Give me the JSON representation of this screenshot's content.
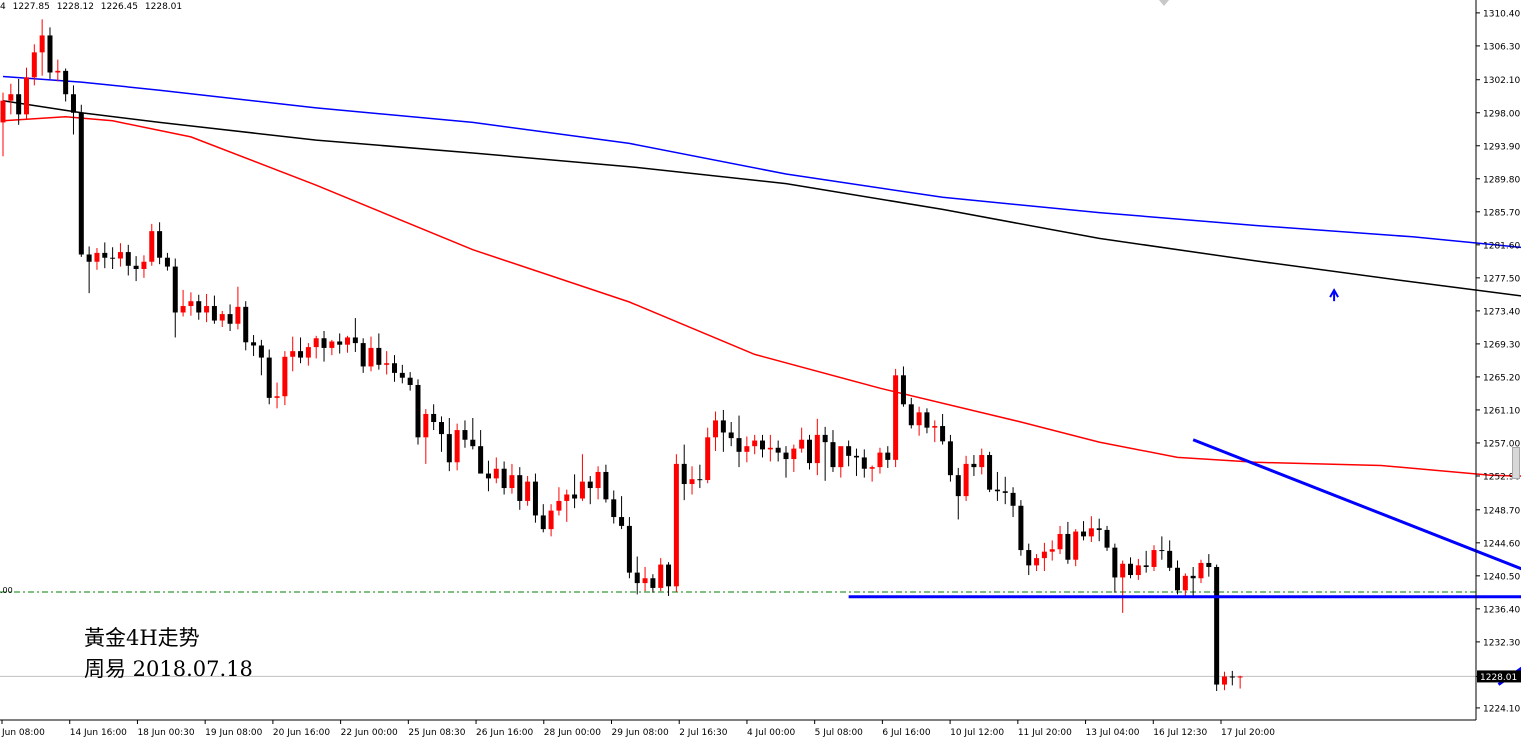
{
  "header": {
    "symbol_fragment": "4",
    "open": "1227.85",
    "high": "1228.12",
    "low": "1226.45",
    "close": "1228.01"
  },
  "caption": {
    "line1": "黃金4H走势",
    "line2": "周易  2018.07.18"
  },
  "level_tag": ".00",
  "colors": {
    "bull": "#ff0000",
    "bear": "#000000",
    "ma_red": "#ff0000",
    "ma_black": "#000000",
    "ma_blue": "#0000ff",
    "annotation": "#0000ff",
    "dashed_level": "#008000",
    "price_line": "#c0c0c0"
  },
  "chart_data": {
    "type": "candlestick",
    "title": "",
    "y_axis": {
      "side": "right",
      "range": [
        1222.6,
        1312.0
      ],
      "ticks": [
        "1310.40",
        "1306.30",
        "1302.10",
        "1298.00",
        "1293.90",
        "1289.80",
        "1285.70",
        "1281.60",
        "1277.50",
        "1273.40",
        "1269.30",
        "1265.20",
        "1261.10",
        "1257.00",
        "1252.90",
        "1248.70",
        "1244.60",
        "1240.50",
        "1236.40",
        "1232.30",
        "1228.01",
        "1224.10"
      ],
      "current_price_label": "1228.01"
    },
    "x_axis": {
      "labels": [
        "Jun 08:00",
        "14 Jun 16:00",
        "18 Jun 00:30",
        "19 Jun 08:00",
        "20 Jun 16:00",
        "22 Jun 00:00",
        "25 Jun 08:30",
        "26 Jun 16:00",
        "28 Jun 00:00",
        "29 Jun 08:00",
        "2 Jul 16:30",
        "4 Jul 00:00",
        "5 Jul 08:00",
        "6 Jul 16:00",
        "10 Jul 12:00",
        "11 Jul 20:00",
        "13 Jul 04:00",
        "16 Jul 12:30",
        "17 Jul 20:00"
      ]
    },
    "candles": [
      [
        1296.8,
        1300.5,
        1292.6,
        1299.5
      ],
      [
        1299.5,
        1301.6,
        1297.8,
        1300.3
      ],
      [
        1300.3,
        1302.2,
        1296.5,
        1297.8
      ],
      [
        1297.8,
        1303.6,
        1297.2,
        1302.4
      ],
      [
        1302.4,
        1306.5,
        1301.4,
        1305.5
      ],
      [
        1305.5,
        1309.6,
        1302.6,
        1307.6
      ],
      [
        1307.6,
        1308.6,
        1302.2,
        1303.0
      ],
      [
        1303.0,
        1304.6,
        1301.9,
        1303.2
      ],
      [
        1303.2,
        1303.5,
        1299.4,
        1300.3
      ],
      [
        1300.3,
        1301.4,
        1295.3,
        1298.0
      ],
      [
        1298.0,
        1299.0,
        1280.1,
        1280.4
      ],
      [
        1280.4,
        1281.4,
        1275.6,
        1279.5
      ],
      [
        1279.5,
        1281.2,
        1278.5,
        1280.6
      ],
      [
        1280.6,
        1281.9,
        1278.7,
        1280.0
      ],
      [
        1280.0,
        1281.3,
        1278.6,
        1279.9
      ],
      [
        1279.9,
        1281.8,
        1278.9,
        1280.7
      ],
      [
        1280.7,
        1281.6,
        1277.8,
        1279.0
      ],
      [
        1279.0,
        1280.2,
        1277.1,
        1278.6
      ],
      [
        1278.6,
        1280.3,
        1277.5,
        1279.5
      ],
      [
        1279.5,
        1284.2,
        1279.0,
        1283.3
      ],
      [
        1283.3,
        1284.4,
        1279.2,
        1280.0
      ],
      [
        1280.0,
        1280.6,
        1278.4,
        1278.9
      ],
      [
        1278.9,
        1279.9,
        1270.1,
        1273.2
      ],
      [
        1273.2,
        1276.0,
        1272.7,
        1274.0
      ],
      [
        1274.0,
        1275.7,
        1272.8,
        1274.6
      ],
      [
        1274.6,
        1275.4,
        1272.3,
        1273.2
      ],
      [
        1273.2,
        1275.5,
        1272.0,
        1274.0
      ],
      [
        1274.0,
        1275.3,
        1271.8,
        1272.2
      ],
      [
        1272.2,
        1273.4,
        1271.4,
        1273.0
      ],
      [
        1273.0,
        1274.2,
        1270.9,
        1271.8
      ],
      [
        1271.8,
        1276.4,
        1271.1,
        1273.9
      ],
      [
        1273.9,
        1274.6,
        1268.5,
        1269.5
      ],
      [
        1269.5,
        1270.4,
        1267.8,
        1269.1
      ],
      [
        1269.1,
        1269.8,
        1265.4,
        1267.6
      ],
      [
        1267.6,
        1268.6,
        1261.8,
        1262.6
      ],
      [
        1262.6,
        1264.5,
        1261.3,
        1262.8
      ],
      [
        1262.8,
        1268.4,
        1261.7,
        1267.7
      ],
      [
        1267.7,
        1270.2,
        1265.9,
        1268.4
      ],
      [
        1268.4,
        1270.1,
        1266.9,
        1267.6
      ],
      [
        1267.6,
        1269.4,
        1266.6,
        1268.9
      ],
      [
        1268.9,
        1270.3,
        1267.5,
        1270.0
      ],
      [
        1270.0,
        1270.9,
        1267.1,
        1268.8
      ],
      [
        1268.8,
        1269.8,
        1267.9,
        1269.6
      ],
      [
        1269.6,
        1270.6,
        1268.1,
        1269.2
      ],
      [
        1269.2,
        1270.3,
        1268.2,
        1270.1
      ],
      [
        1270.1,
        1272.5,
        1268.3,
        1269.4
      ],
      [
        1269.4,
        1270.0,
        1265.7,
        1266.5
      ],
      [
        1266.5,
        1270.2,
        1265.9,
        1268.8
      ],
      [
        1268.8,
        1270.6,
        1266.1,
        1266.7
      ],
      [
        1266.7,
        1268.4,
        1265.5,
        1266.9
      ],
      [
        1266.9,
        1267.9,
        1264.6,
        1265.7
      ],
      [
        1265.7,
        1266.7,
        1264.4,
        1265.1
      ],
      [
        1265.1,
        1265.8,
        1263.5,
        1264.2
      ],
      [
        1264.2,
        1264.9,
        1256.8,
        1257.7
      ],
      [
        1257.7,
        1261.2,
        1254.4,
        1260.6
      ],
      [
        1260.6,
        1261.8,
        1258.6,
        1259.6
      ],
      [
        1259.6,
        1260.3,
        1255.9,
        1258.1
      ],
      [
        1258.1,
        1260.1,
        1253.5,
        1254.6
      ],
      [
        1254.6,
        1259.4,
        1253.6,
        1258.6
      ],
      [
        1258.6,
        1259.8,
        1256.4,
        1257.4
      ],
      [
        1257.4,
        1260.1,
        1256.2,
        1256.6
      ],
      [
        1256.6,
        1258.6,
        1253.5,
        1253.2
      ],
      [
        1253.2,
        1254.8,
        1251.0,
        1252.6
      ],
      [
        1252.6,
        1255.2,
        1252.0,
        1253.8
      ],
      [
        1253.8,
        1254.7,
        1250.6,
        1251.4
      ],
      [
        1251.4,
        1254.4,
        1250.7,
        1253.0
      ],
      [
        1253.0,
        1254.0,
        1248.7,
        1249.8
      ],
      [
        1249.8,
        1252.9,
        1249.2,
        1252.2
      ],
      [
        1252.2,
        1253.2,
        1247.1,
        1248.0
      ],
      [
        1248.0,
        1249.4,
        1245.9,
        1246.3
      ],
      [
        1246.3,
        1249.4,
        1245.4,
        1248.6
      ],
      [
        1248.6,
        1251.5,
        1248.0,
        1249.8
      ],
      [
        1249.8,
        1251.2,
        1247.2,
        1250.6
      ],
      [
        1250.6,
        1253.1,
        1248.9,
        1250.1
      ],
      [
        1250.1,
        1255.6,
        1249.8,
        1252.2
      ],
      [
        1252.2,
        1252.9,
        1249.4,
        1251.4
      ],
      [
        1251.4,
        1254.1,
        1250.0,
        1253.4
      ],
      [
        1253.4,
        1254.3,
        1249.6,
        1250.0
      ],
      [
        1250.0,
        1251.1,
        1247.0,
        1247.8
      ],
      [
        1247.8,
        1250.4,
        1246.3,
        1246.7
      ],
      [
        1246.7,
        1247.8,
        1240.2,
        1240.9
      ],
      [
        1240.9,
        1242.9,
        1238.2,
        1239.6
      ],
      [
        1239.6,
        1241.6,
        1238.6,
        1240.2
      ],
      [
        1240.2,
        1240.7,
        1238.4,
        1239.0
      ],
      [
        1239.0,
        1242.7,
        1238.6,
        1241.9
      ],
      [
        1241.9,
        1242.2,
        1238.0,
        1239.2
      ],
      [
        1239.2,
        1255.6,
        1238.5,
        1254.4
      ],
      [
        1254.4,
        1256.8,
        1249.9,
        1251.9
      ],
      [
        1251.9,
        1254.1,
        1250.6,
        1252.5
      ],
      [
        1252.5,
        1254.3,
        1251.4,
        1252.4
      ],
      [
        1252.4,
        1258.9,
        1252.0,
        1257.7
      ],
      [
        1257.7,
        1260.9,
        1256.0,
        1259.8
      ],
      [
        1259.8,
        1261.1,
        1255.9,
        1258.3
      ],
      [
        1258.3,
        1259.6,
        1256.6,
        1257.6
      ],
      [
        1257.6,
        1260.4,
        1254.0,
        1255.9
      ],
      [
        1255.9,
        1257.8,
        1254.6,
        1256.6
      ],
      [
        1256.6,
        1258.0,
        1255.6,
        1257.3
      ],
      [
        1257.3,
        1258.0,
        1255.2,
        1256.2
      ],
      [
        1256.2,
        1258.0,
        1254.7,
        1256.4
      ],
      [
        1256.4,
        1257.3,
        1254.7,
        1255.8
      ],
      [
        1255.8,
        1256.6,
        1252.7,
        1255.0
      ],
      [
        1255.0,
        1256.8,
        1253.4,
        1256.3
      ],
      [
        1256.3,
        1258.9,
        1255.8,
        1257.4
      ],
      [
        1257.4,
        1258.0,
        1253.7,
        1254.5
      ],
      [
        1254.5,
        1260.0,
        1253.0,
        1258.0
      ],
      [
        1258.0,
        1259.0,
        1252.3,
        1257.1
      ],
      [
        1257.1,
        1258.6,
        1253.4,
        1254.0
      ],
      [
        1254.0,
        1256.1,
        1252.7,
        1256.6
      ],
      [
        1256.6,
        1257.3,
        1254.1,
        1255.4
      ],
      [
        1255.4,
        1256.3,
        1252.9,
        1255.2
      ],
      [
        1255.2,
        1256.2,
        1252.7,
        1253.8
      ],
      [
        1253.8,
        1254.2,
        1252.2,
        1254.0
      ],
      [
        1254.0,
        1256.4,
        1253.2,
        1255.8
      ],
      [
        1255.8,
        1256.6,
        1253.9,
        1254.9
      ],
      [
        1254.9,
        1266.2,
        1254.0,
        1265.4
      ],
      [
        1265.4,
        1266.5,
        1261.5,
        1261.8
      ],
      [
        1261.8,
        1262.6,
        1258.8,
        1259.2
      ],
      [
        1259.2,
        1261.5,
        1257.9,
        1260.8
      ],
      [
        1260.8,
        1261.3,
        1258.2,
        1258.9
      ],
      [
        1258.9,
        1259.8,
        1257.1,
        1259.1
      ],
      [
        1259.1,
        1260.6,
        1256.8,
        1257.2
      ],
      [
        1257.2,
        1258.0,
        1252.2,
        1253.0
      ],
      [
        1253.0,
        1253.9,
        1247.5,
        1250.4
      ],
      [
        1250.4,
        1255.4,
        1249.8,
        1254.4
      ],
      [
        1254.4,
        1255.5,
        1252.9,
        1254.0
      ],
      [
        1254.0,
        1256.3,
        1253.1,
        1255.5
      ],
      [
        1255.5,
        1255.9,
        1250.9,
        1251.2
      ],
      [
        1251.2,
        1253.4,
        1249.8,
        1251.0
      ],
      [
        1251.0,
        1252.8,
        1249.4,
        1250.8
      ],
      [
        1250.8,
        1251.5,
        1247.8,
        1249.2
      ],
      [
        1249.2,
        1249.9,
        1243.0,
        1243.7
      ],
      [
        1243.7,
        1244.5,
        1240.6,
        1241.8
      ],
      [
        1241.8,
        1243.2,
        1241.1,
        1242.7
      ],
      [
        1242.7,
        1244.6,
        1241.1,
        1243.5
      ],
      [
        1243.5,
        1244.9,
        1242.4,
        1243.8
      ],
      [
        1243.8,
        1246.7,
        1243.2,
        1245.7
      ],
      [
        1245.7,
        1247.2,
        1242.0,
        1242.5
      ],
      [
        1242.5,
        1246.3,
        1241.7,
        1246.0
      ],
      [
        1246.0,
        1247.3,
        1244.9,
        1245.4
      ],
      [
        1245.4,
        1247.9,
        1244.7,
        1246.4
      ],
      [
        1246.4,
        1247.6,
        1244.8,
        1246.2
      ],
      [
        1246.2,
        1246.7,
        1243.6,
        1244.0
      ],
      [
        1244.0,
        1244.5,
        1238.4,
        1240.3
      ],
      [
        1240.3,
        1242.4,
        1235.9,
        1242.0
      ],
      [
        1242.0,
        1242.8,
        1240.2,
        1240.6
      ],
      [
        1240.6,
        1242.6,
        1240.0,
        1241.8
      ],
      [
        1241.8,
        1243.6,
        1240.9,
        1241.6
      ],
      [
        1241.6,
        1244.3,
        1241.1,
        1243.7
      ],
      [
        1243.7,
        1245.4,
        1242.5,
        1243.6
      ],
      [
        1243.6,
        1244.9,
        1241.1,
        1241.5
      ],
      [
        1241.5,
        1242.4,
        1238.2,
        1238.7
      ],
      [
        1238.7,
        1240.8,
        1238.0,
        1240.5
      ],
      [
        1240.5,
        1241.6,
        1237.8,
        1240.2
      ],
      [
        1240.2,
        1242.5,
        1239.6,
        1242.1
      ],
      [
        1242.1,
        1243.2,
        1240.4,
        1241.6
      ],
      [
        1241.6,
        1241.9,
        1226.2,
        1227.0
      ],
      [
        1227.0,
        1228.6,
        1226.3,
        1228.0
      ],
      [
        1228.0,
        1228.7,
        1226.9,
        1227.9
      ],
      [
        1227.9,
        1228.1,
        1226.5,
        1228.0
      ]
    ],
    "moving_averages": [
      {
        "color": "#ff0000",
        "values": [
          [
            0,
            1297.0
          ],
          [
            8,
            1297.5
          ],
          [
            14,
            1297.0
          ],
          [
            24,
            1295.0
          ],
          [
            40,
            1289.0
          ],
          [
            60,
            1281.0
          ],
          [
            80,
            1274.5
          ],
          [
            96,
            1268.0
          ],
          [
            112,
            1263.8
          ],
          [
            130,
            1259.6
          ],
          [
            140,
            1257.1
          ],
          [
            150,
            1255.2
          ],
          [
            160,
            1254.6
          ],
          [
            176,
            1254.2
          ],
          [
            190,
            1253.0
          ],
          [
            210,
            1252.4
          ],
          [
            224,
            1251.2
          ],
          [
            240,
            1249.4
          ],
          [
            250,
            1249.2
          ],
          [
            256,
            1248.3
          ]
        ]
      },
      {
        "color": "#000000",
        "values": [
          [
            0,
            1299.5
          ],
          [
            10,
            1298.0
          ],
          [
            20,
            1296.8
          ],
          [
            40,
            1294.6
          ],
          [
            60,
            1293.0
          ],
          [
            80,
            1291.3
          ],
          [
            100,
            1289.2
          ],
          [
            120,
            1286.0
          ],
          [
            140,
            1282.4
          ],
          [
            160,
            1279.6
          ],
          [
            180,
            1277.0
          ],
          [
            200,
            1274.5
          ],
          [
            220,
            1272.3
          ],
          [
            240,
            1269.0
          ],
          [
            256,
            1266.0
          ]
        ]
      },
      {
        "color": "#0000ff",
        "values": [
          [
            0,
            1302.5
          ],
          [
            10,
            1301.8
          ],
          [
            20,
            1300.8
          ],
          [
            40,
            1298.6
          ],
          [
            60,
            1296.8
          ],
          [
            80,
            1294.2
          ],
          [
            100,
            1290.4
          ],
          [
            120,
            1287.5
          ],
          [
            140,
            1285.6
          ],
          [
            160,
            1284.0
          ],
          [
            180,
            1282.6
          ],
          [
            200,
            1280.7
          ],
          [
            220,
            1278.8
          ],
          [
            240,
            1275.4
          ],
          [
            256,
            1272.4
          ]
        ]
      }
    ],
    "levels": [
      {
        "style": "dash-dot",
        "color": "#008000",
        "price": 1238.5
      },
      {
        "style": "solid",
        "color": "#c0c0c0",
        "price": 1228.01
      }
    ],
    "annotations": [
      {
        "kind": "trendline",
        "color": "#0000ff",
        "from": [
          152,
          1257.4
        ],
        "to": [
          203,
          1237.9
        ]
      },
      {
        "kind": "horizontal_segment",
        "color": "#0000ff",
        "from": [
          108,
          1237.9
        ],
        "to": [
          218,
          1237.9
        ]
      },
      {
        "kind": "arrow_path",
        "color": "#0000ff",
        "points": [
          [
            191,
            1227.0
          ],
          [
            204,
            1236.0
          ],
          [
            217,
            1223.0
          ]
        ]
      },
      {
        "kind": "arrow_mark",
        "color": "#0000ff",
        "at": [
          170,
          1275.6
        ]
      }
    ]
  }
}
